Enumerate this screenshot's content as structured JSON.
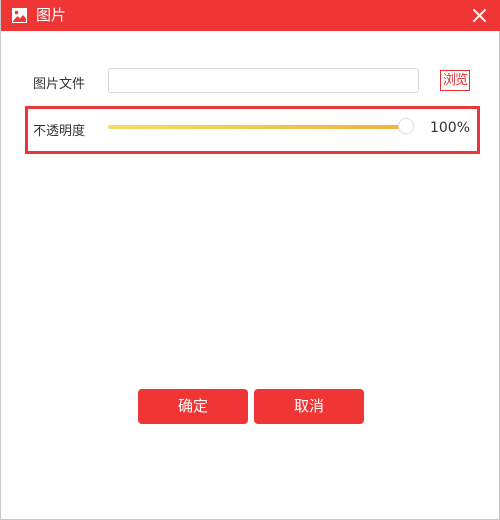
{
  "window": {
    "title": "图片",
    "title_icon": "image-icon",
    "close_icon": "close-icon",
    "accent_color": "#f03535"
  },
  "file_row": {
    "label": "图片文件",
    "input_value": "",
    "browse_label": "浏览"
  },
  "opacity_row": {
    "label": "不透明度",
    "value_text": "100%",
    "value_fraction": 1.0,
    "track_gradient": [
      "#f5dc63",
      "#f0b43a"
    ],
    "highlight_color": "#e8373a"
  },
  "footer": {
    "ok_label": "确定",
    "cancel_label": "取消"
  }
}
